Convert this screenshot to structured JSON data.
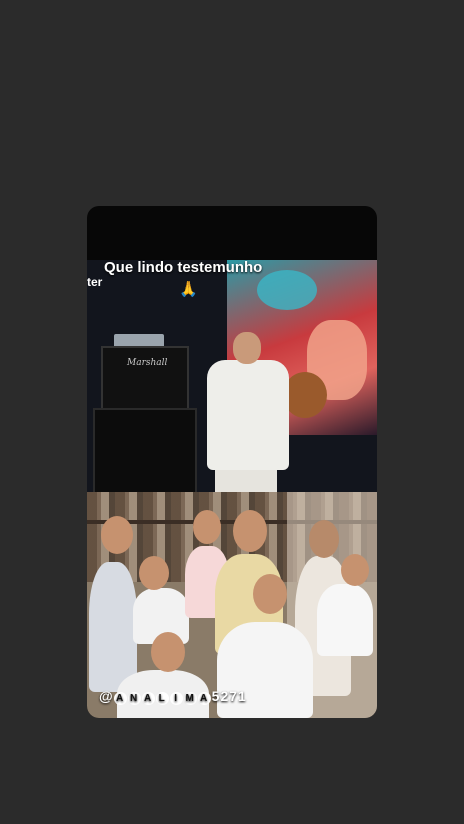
{
  "story": {
    "caption": "Que lindo testemunho",
    "caption_emoji": "🙏",
    "side_fragment": "ter",
    "amp_brand": "Marshall",
    "watermark_prefix": "@",
    "watermark_letters": [
      "A",
      "N",
      "A",
      "L",
      "I",
      "M",
      "A"
    ],
    "watermark_suffix": "5271"
  },
  "colors": {
    "page_background": "#2b2b2b",
    "card_background": "#070707",
    "caption_text": "#ffffff"
  }
}
